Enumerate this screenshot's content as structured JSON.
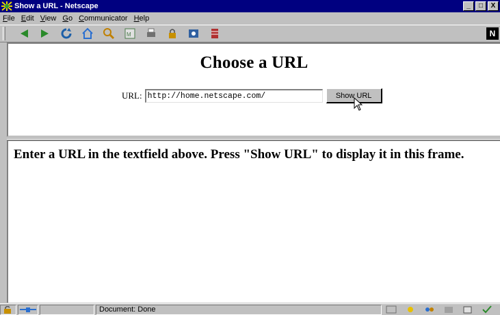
{
  "window": {
    "title": "Show a URL - Netscape",
    "controls": [
      "_",
      "□",
      "X"
    ]
  },
  "menubar": {
    "items": [
      {
        "label": "File",
        "mnemonic": "F"
      },
      {
        "label": "Edit",
        "mnemonic": "E"
      },
      {
        "label": "View",
        "mnemonic": "V"
      },
      {
        "label": "Go",
        "mnemonic": "G"
      },
      {
        "label": "Communicator",
        "mnemonic": "C"
      },
      {
        "label": "Help",
        "mnemonic": "H"
      }
    ]
  },
  "toolbar": {
    "buttons": [
      {
        "name": "back-icon",
        "color": "#2a8a2a"
      },
      {
        "name": "forward-icon",
        "color": "#2a8a2a"
      },
      {
        "name": "reload-icon",
        "color": "#1c5fa8"
      },
      {
        "name": "home-icon",
        "color": "#2a6fd0"
      },
      {
        "name": "search-icon",
        "color": "#c08000"
      },
      {
        "name": "netscape-guide-icon",
        "color": "#4a7a4a"
      },
      {
        "name": "print-icon",
        "color": "#707070"
      },
      {
        "name": "security-icon",
        "color": "#c89000"
      },
      {
        "name": "shop-icon",
        "color": "#3060a0"
      },
      {
        "name": "stop-icon",
        "color": "#b03030"
      }
    ],
    "throbber": "N"
  },
  "top_frame": {
    "heading": "Choose a URL",
    "url_label": "URL:",
    "url_value": "http://home.netscape.com/",
    "button_label": "Show URL"
  },
  "bottom_frame": {
    "message": "Enter a URL in the textfield above. Press \"Show URL\" to display it in this frame."
  },
  "statusbar": {
    "status_text": "Document: Done"
  }
}
